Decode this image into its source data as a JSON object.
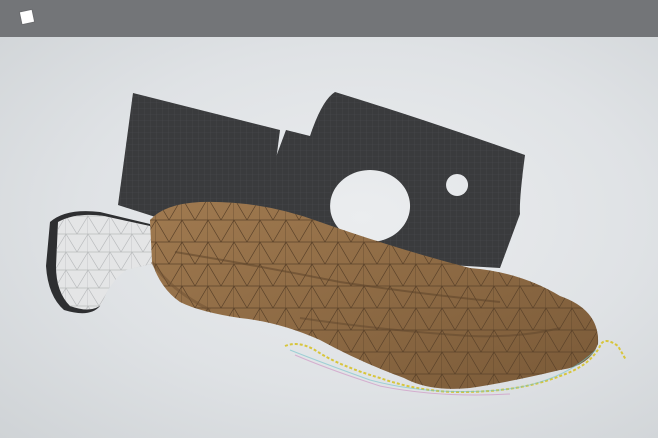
{
  "app": {
    "icon": "app-square-icon"
  },
  "scene": {
    "background_color": "#dfe2e5",
    "objects": [
      {
        "name": "dark-plate-left",
        "color": "#3a3b3d"
      },
      {
        "name": "dark-plate-right-with-holes",
        "color": "#3a3b3d"
      },
      {
        "name": "white-mesh-handle",
        "color": "#e4e5e6"
      },
      {
        "name": "brown-mesh-hand",
        "color": "#8d6a45"
      },
      {
        "name": "wire-curve-outline",
        "color": "#d7c53c"
      }
    ]
  }
}
